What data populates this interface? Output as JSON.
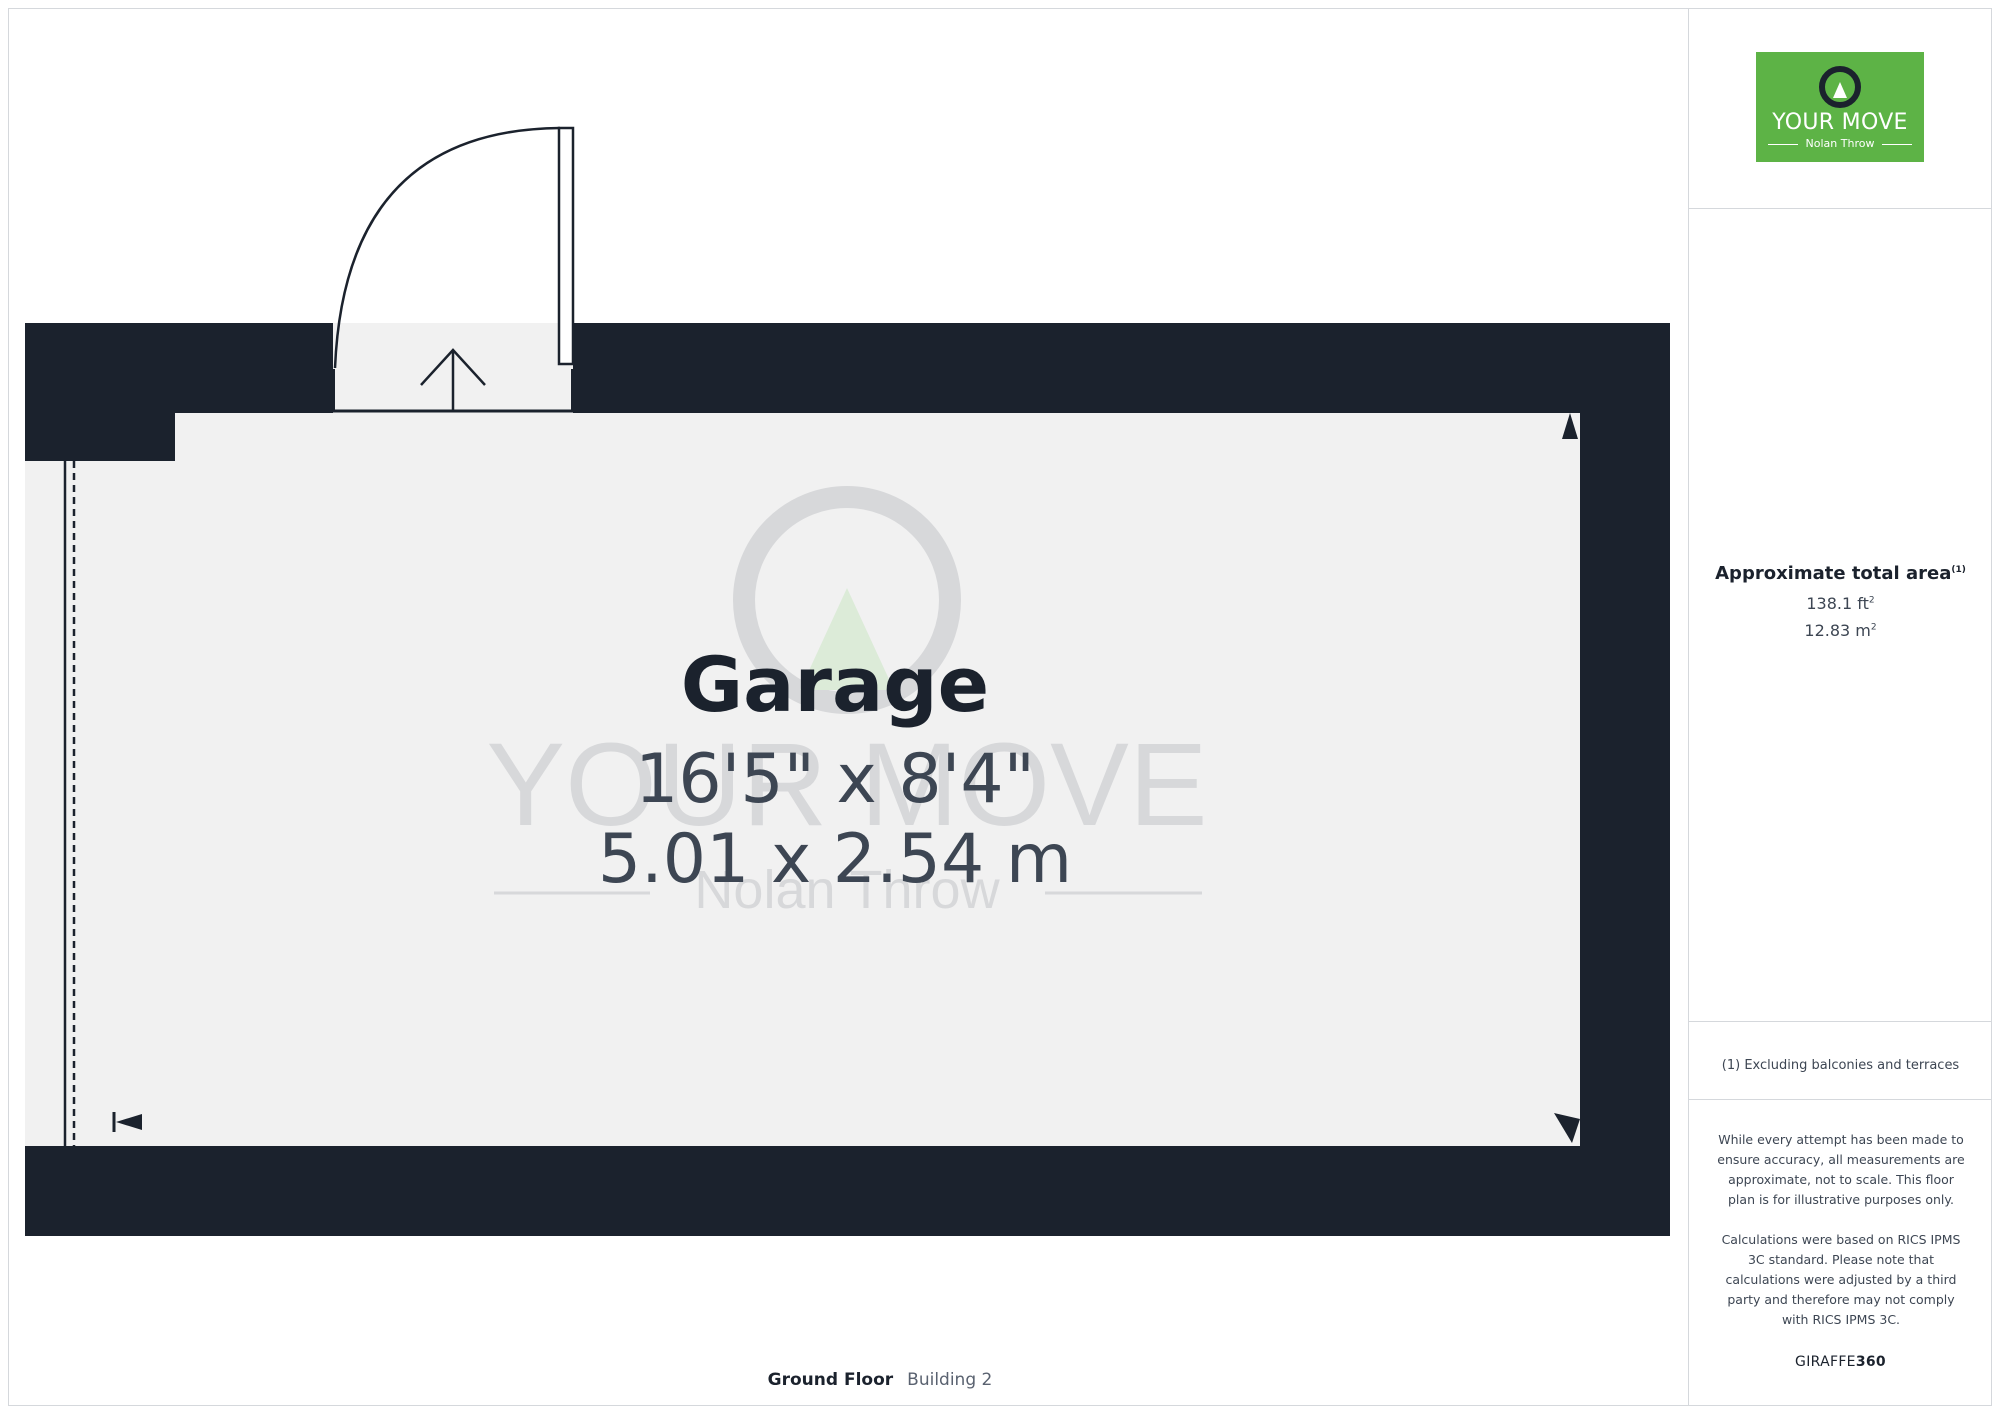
{
  "room": {
    "name": "Garage",
    "dim_imperial": "16'5\" x 8'4\"",
    "dim_metric": "5.01 x 2.54 m"
  },
  "floor": {
    "label": "Ground Floor",
    "building": "Building 2"
  },
  "watermark": {
    "brand": "YOUR MOVE",
    "sub": "Nolan Throw"
  },
  "logo": {
    "brand": "YOUR MOVE",
    "sub": "Nolan Throw",
    "icon": "your-move-pin-icon",
    "color": "#5db346"
  },
  "area": {
    "title": "Approximate total area",
    "title_note": "(1)",
    "value_ft": "138.1 ft",
    "value_ft_sup": "2",
    "value_m": "12.83 m",
    "value_m_sup": "2"
  },
  "footnote": "(1) Excluding balconies and terraces",
  "disclaimer": {
    "p1": "While every attempt has been made to ensure accuracy, all measurements are approximate, not to scale. This floor plan is for illustrative purposes only.",
    "p2": "Calculations were based on RICS IPMS 3C standard. Please note that calculations were adjusted by a third party and therefore may not comply with RICS IPMS 3C."
  },
  "credit": {
    "part1": "GIRAFFE",
    "part2": "360"
  },
  "colors": {
    "wall": "#1b222d",
    "floor": "#f1f1f1",
    "accent": "#5db346"
  }
}
